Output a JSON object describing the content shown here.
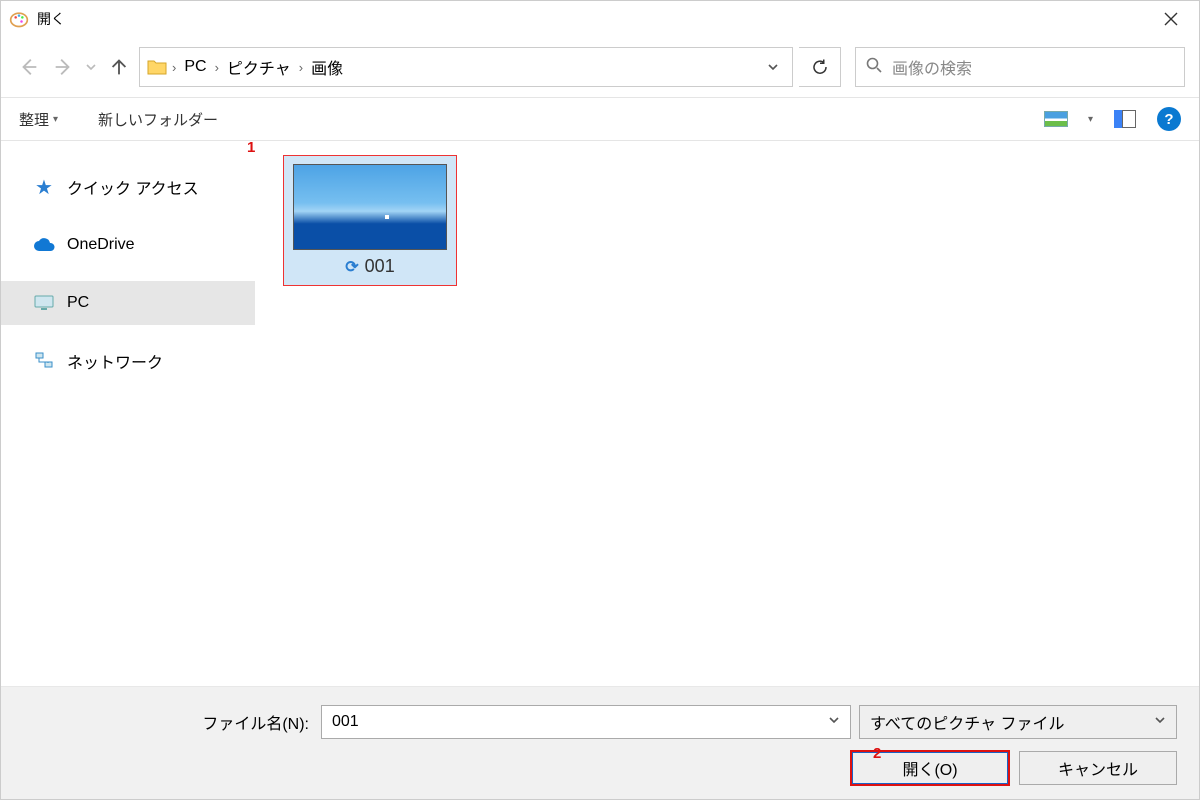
{
  "window": {
    "title": "開く"
  },
  "address": {
    "crumbs": [
      "PC",
      "ピクチャ",
      "画像"
    ]
  },
  "search": {
    "placeholder": "画像の検索"
  },
  "toolbar": {
    "organize": "整理",
    "newfolder": "新しいフォルダー"
  },
  "sidebar": {
    "items": [
      {
        "label": "クイック アクセス",
        "icon": "star"
      },
      {
        "label": "OneDrive",
        "icon": "cloud"
      },
      {
        "label": "PC",
        "icon": "pc"
      },
      {
        "label": "ネットワーク",
        "icon": "net"
      }
    ]
  },
  "content": {
    "items": [
      {
        "name": "001"
      }
    ]
  },
  "callouts": {
    "one": "1",
    "two": "2"
  },
  "footer": {
    "filename_label": "ファイル名(N):",
    "filename": "001",
    "filetype": "すべてのピクチャ ファイル",
    "open_btn": "開く(O)",
    "cancel_btn": "キャンセル"
  }
}
